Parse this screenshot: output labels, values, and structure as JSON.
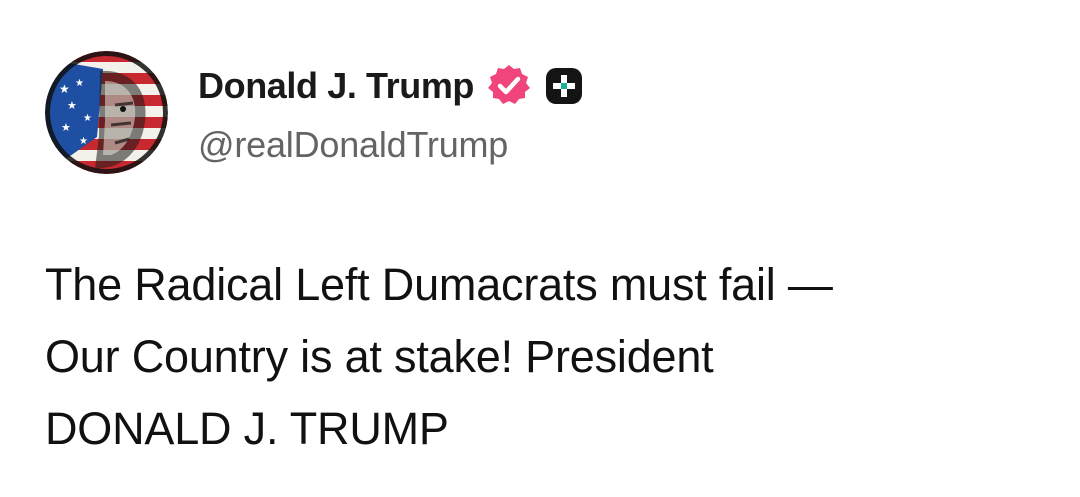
{
  "post": {
    "author": {
      "display_name": "Donald J. Trump",
      "handle": "@realDonaldTrump",
      "avatar_icon": "flag-portrait-avatar",
      "verified_icon": "verified-badge-icon",
      "plus_icon": "plus-badge-icon"
    },
    "body_lines": [
      "The Radical Left Dumacrats must fail —",
      "Our Country is at stake! President",
      "DONALD J. TRUMP"
    ]
  },
  "colors": {
    "verified_badge": "#f0457a",
    "plus_badge": "#141414",
    "plus_badge_accent": "#19b19a",
    "name_text": "#1a1a1a",
    "handle_text": "#646464",
    "body_text": "#111111"
  }
}
